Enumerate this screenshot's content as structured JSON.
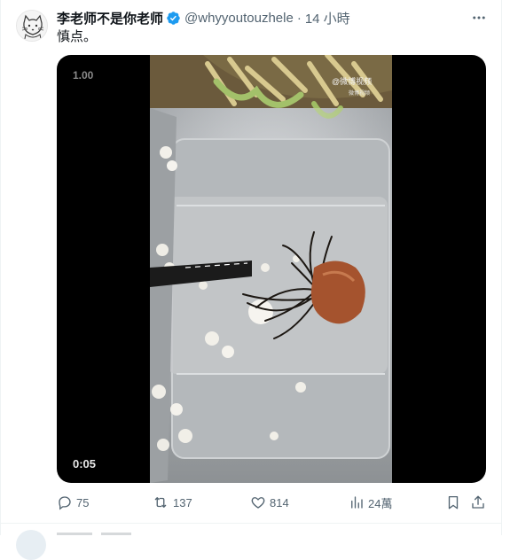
{
  "post": {
    "display_name": "李老师不是你老师",
    "handle": "@whyyoutouzhele",
    "separator": "·",
    "timestamp": "14 小時",
    "text": "慎点。",
    "avatar_icon": "cat-sketch-avatar",
    "verified_color": "#1d9bf0"
  },
  "video": {
    "playback_rate": "1.00",
    "duration": "0:05",
    "watermark": "@微博视频",
    "watermark_sub": "微博视频"
  },
  "actions": {
    "replies": {
      "icon": "reply-icon",
      "count": "75"
    },
    "reposts": {
      "icon": "repost-icon",
      "count": "137"
    },
    "likes": {
      "icon": "heart-icon",
      "count": "814"
    },
    "views": {
      "icon": "views-chart-icon",
      "count": "24萬"
    },
    "bookmark": {
      "icon": "bookmark-icon"
    },
    "share": {
      "icon": "share-icon"
    }
  },
  "colors": {
    "text_primary": "#0f1419",
    "text_secondary": "#536471",
    "accent": "#1d9bf0",
    "border": "#eff3f4"
  }
}
